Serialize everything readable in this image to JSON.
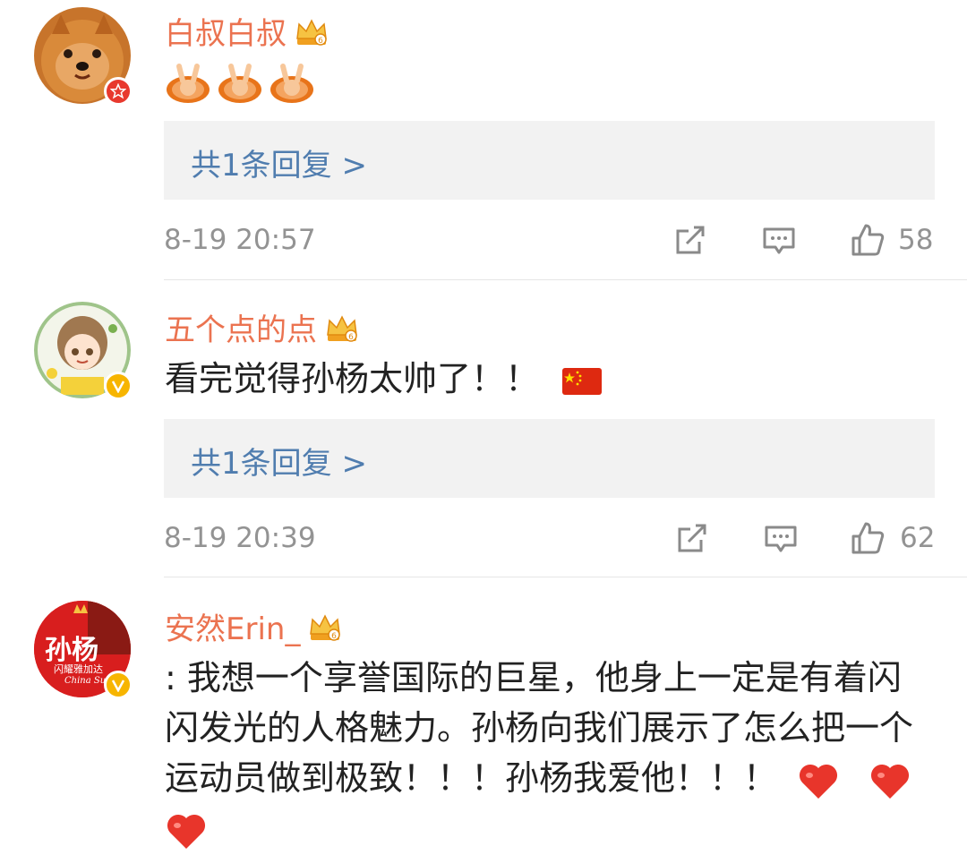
{
  "comments": [
    {
      "username": "白叔白叔",
      "text": "",
      "reply_link": "共1条回复 >",
      "time": "8-19 20:57",
      "likes": "58",
      "badge": "red-star",
      "emoji": [
        "victory-hand-emoji",
        "victory-hand-emoji",
        "victory-hand-emoji"
      ]
    },
    {
      "username": "五个点的点",
      "text": "看完觉得孙杨太帅了！！",
      "reply_link": "共1条回复 >",
      "time": "8-19 20:39",
      "likes": "62",
      "badge": "yellow-v",
      "emoji": [
        "china-flag-emoji"
      ]
    },
    {
      "username": "安然Erin_",
      "text_line1": ": 我想一个享誉国际的巨星，他身上一定是有着闪",
      "text_line2": "闪发光的人格魅力。孙杨向我们展示了怎么把一个",
      "text_line3": "运动员做到极致！！！孙杨我爱他！！！",
      "badge": "yellow-v",
      "avatar_text": "孙杨",
      "avatar_subtext": "闪耀雅加达",
      "avatar_caption": "China Sun",
      "emoji": [
        "red-heart-emoji",
        "red-heart-emoji",
        "red-heart-emoji"
      ]
    }
  ],
  "colors": {
    "username": "#eb7350",
    "link": "#507daf",
    "meta": "#939393",
    "reply_bg": "#f2f2f2"
  }
}
